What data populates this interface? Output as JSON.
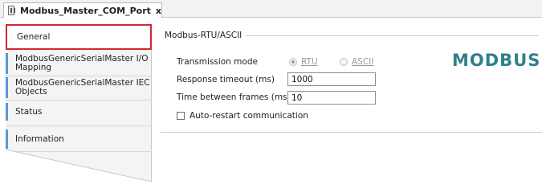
{
  "document_tab": {
    "title": "Modbus_Master_COM_Port",
    "close_label": "x"
  },
  "sidebar": {
    "items": [
      {
        "label": "General"
      },
      {
        "label": "ModbusGenericSerialMaster I/O Mapping"
      },
      {
        "label": "ModbusGenericSerialMaster IEC Objects"
      },
      {
        "label": "Status"
      },
      {
        "label": "Information"
      }
    ],
    "selected_index": 0
  },
  "group": {
    "title": "Modbus-RTU/ASCII",
    "logo_text": "MODBUS",
    "transmission_mode": {
      "label": "Transmission mode",
      "options": [
        {
          "label": "RTU",
          "checked": true,
          "enabled": false
        },
        {
          "label": "ASCII",
          "checked": false,
          "enabled": false
        }
      ]
    },
    "response_timeout": {
      "label": "Response timeout (ms)",
      "value": "1000"
    },
    "time_between_frames": {
      "label": "Time between frames (ms)",
      "value": "10"
    },
    "auto_restart": {
      "label": "Auto-restart communication",
      "checked": false
    }
  },
  "colors": {
    "selected_outline": "#d7262c",
    "tab_accent": "#5b97d6",
    "logo": "#2f7f8b"
  }
}
